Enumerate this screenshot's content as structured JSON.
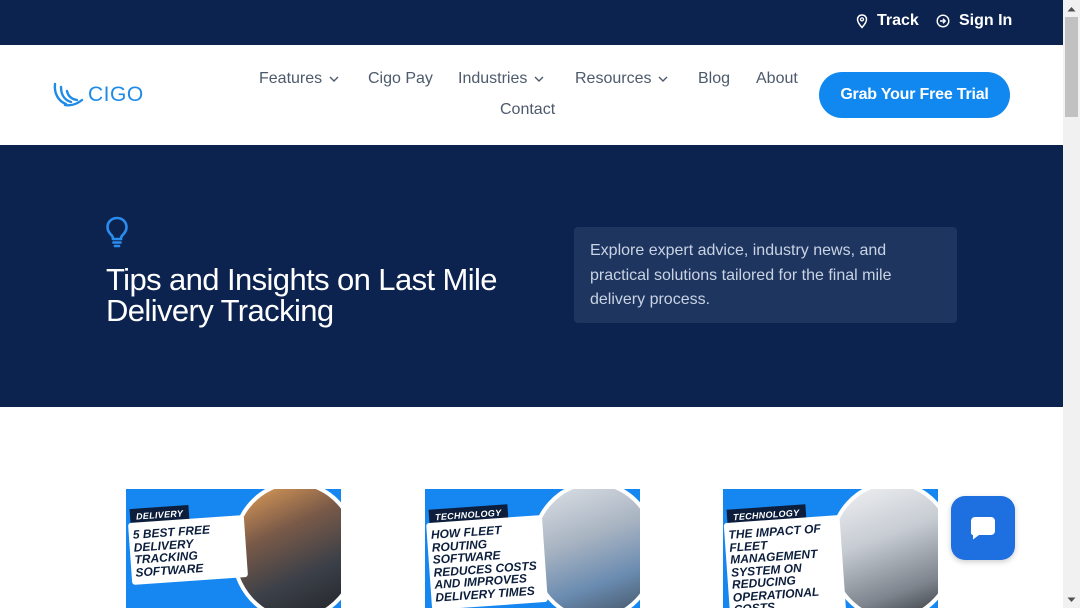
{
  "topbar": {
    "track_label": "Track",
    "signin_label": "Sign In",
    "background": "#0c2350"
  },
  "logo": {
    "text": "CIGO",
    "icon": "cigo-wings-logo"
  },
  "nav": {
    "features": "Features",
    "cigo_pay": "Cigo Pay",
    "industries": "Industries",
    "resources": "Resources",
    "blog": "Blog",
    "about": "About",
    "contact": "Contact"
  },
  "cta": {
    "label": "Grab Your Free Trial",
    "color": "#1188ef"
  },
  "hero": {
    "icon": "lightbulb-icon",
    "title_line1": "Tips and Insights on Last Mile",
    "title_line2": "Delivery Tracking",
    "description": "Explore expert advice, industry news, and practical solutions tailored for the final mile delivery process."
  },
  "cards": [
    {
      "category": "DELIVERY",
      "title": "5 Best Free Delivery Tracking Software"
    },
    {
      "category": "TECHNOLOGY",
      "title": "How Fleet Routing Software Reduces Costs and Improves Delivery Times"
    },
    {
      "category": "TECHNOLOGY",
      "title": "The Impact of Fleet Management System on Reducing Operational Costs"
    }
  ],
  "chat": {
    "icon": "chat-bubble-icon"
  }
}
